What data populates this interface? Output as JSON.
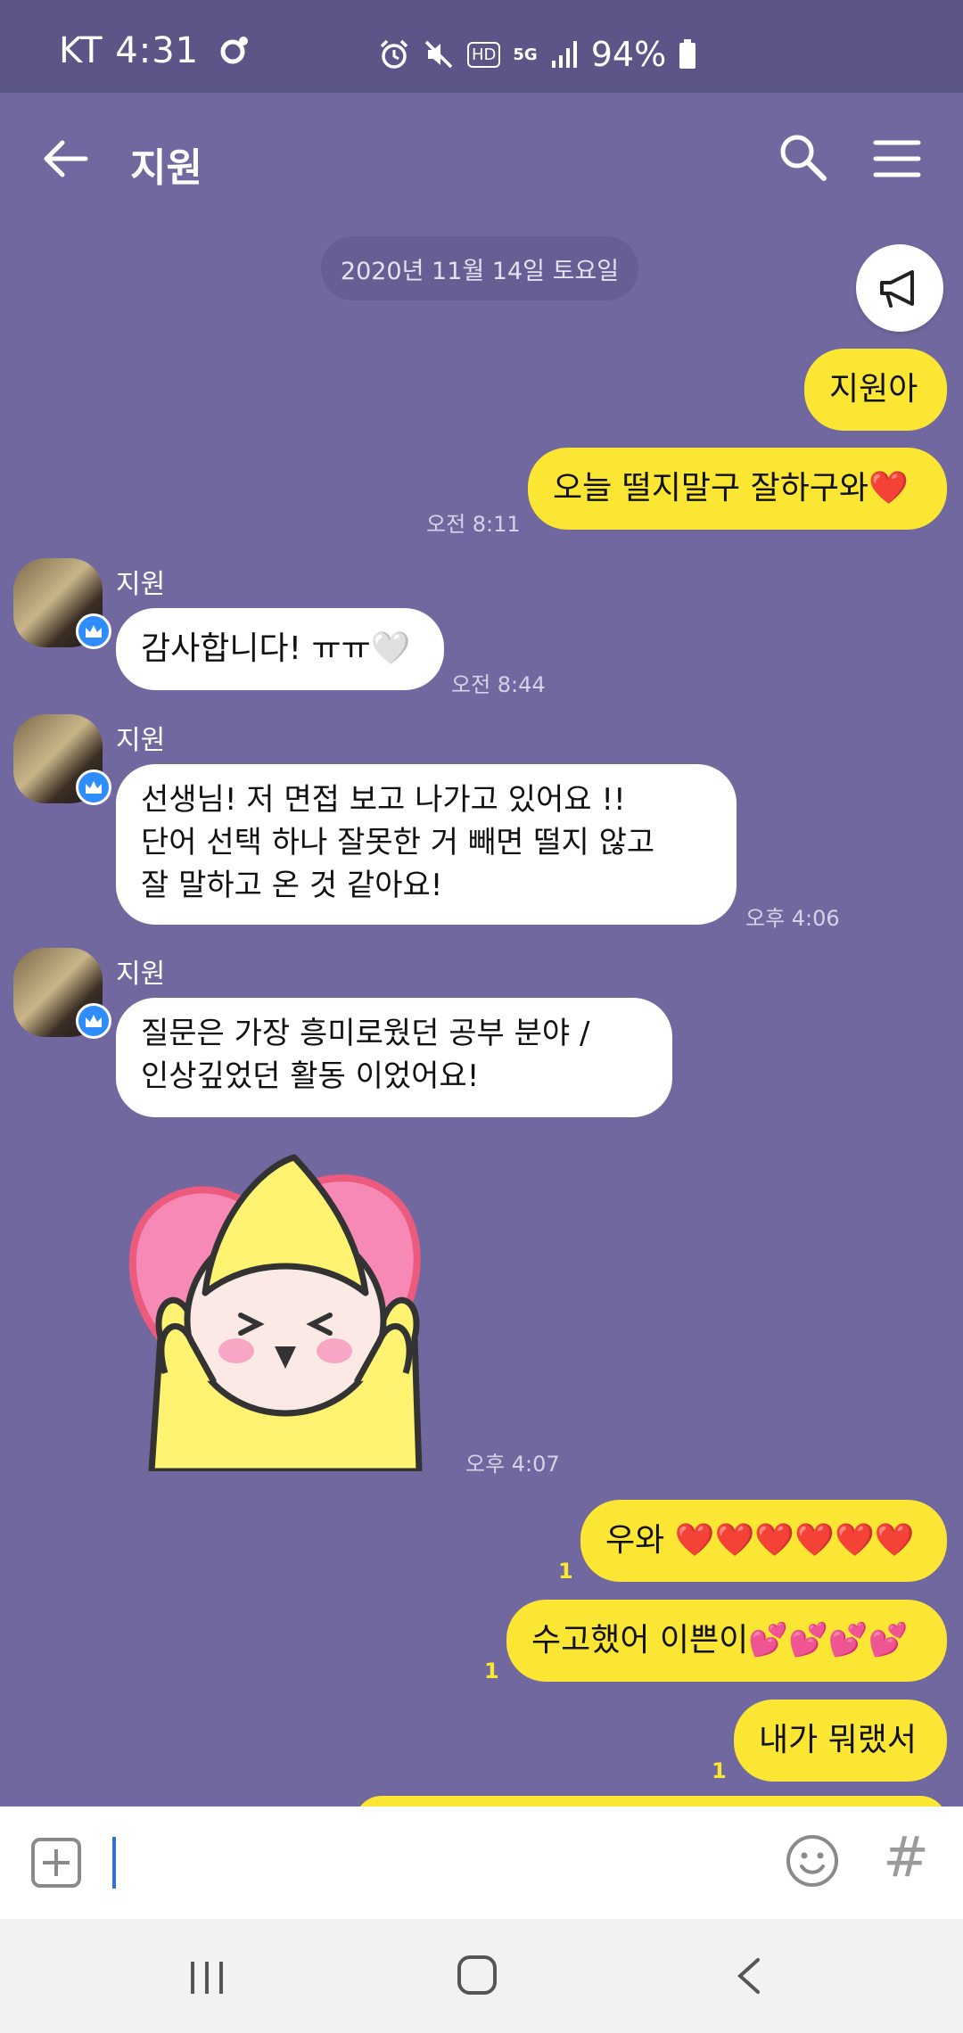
{
  "status_bar": {
    "carrier_time": "KT 4:31",
    "network": "5G",
    "hd_label": "HD",
    "battery": "94%"
  },
  "header": {
    "title": "지원"
  },
  "date_divider": "2020년 11월 14일 토요일",
  "messages": [
    {
      "side": "me",
      "text": "지원아"
    },
    {
      "side": "me",
      "text": "오늘 떨지말구 잘하구와❤️",
      "time": "오전 8:11"
    },
    {
      "side": "them",
      "sender": "지원",
      "text": "감사합니다! ㅠㅠ🤍",
      "time": "오전 8:44"
    },
    {
      "side": "them",
      "sender": "지원",
      "text": "선생님! 저 면접 보고 나가고 있어요 !!\n단어 선택 하나 잘못한 거 빼면 떨지 않고\n잘 말하고 온 것 같아요!",
      "time": "오후 4:06"
    },
    {
      "side": "them",
      "sender": "지원",
      "text": "질문은 가장 흥미로웠던 공부 분야 /\n인상깊었던 활동 이었어요!"
    },
    {
      "side": "them",
      "sticker": "heart-character-sticker",
      "time": "오후 4:07"
    },
    {
      "side": "me",
      "text": "우와 ❤️❤️❤️❤️❤️❤️",
      "read": "1"
    },
    {
      "side": "me",
      "text": "수고했어 이쁜이💕💕💕💕",
      "read": "1"
    },
    {
      "side": "me",
      "text": "내가 뭐랬서",
      "read": "1"
    }
  ],
  "input": {
    "placeholder": ""
  },
  "colors": {
    "background": "#7268a0",
    "status_bar": "#5c5588",
    "my_bubble": "#fbe634",
    "their_bubble": "#ffffff"
  }
}
